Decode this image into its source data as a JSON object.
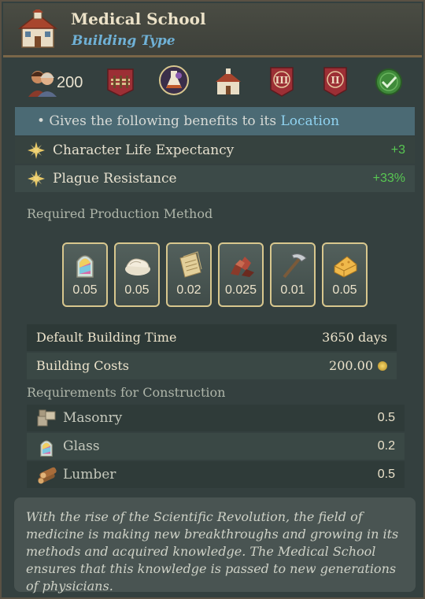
{
  "header": {
    "title": "Medical School",
    "subtitle": "Building Type",
    "icon": "school-building-icon"
  },
  "icon_bar": {
    "population": "200",
    "items": [
      "population-icon",
      "railway-icon",
      "medicine-flask-icon",
      "school-building-icon",
      "tier-three-banner-icon",
      "tier-two-banner-icon",
      "checkmark-icon"
    ],
    "tier_labels": [
      "III",
      "II"
    ]
  },
  "benefits": {
    "intro_prefix": "• Gives the following benefits to its ",
    "intro_link": "Location",
    "modifiers": [
      {
        "label": "Character Life Expectancy",
        "value": "+3"
      },
      {
        "label": "Plague Resistance",
        "value": "+33%"
      }
    ]
  },
  "production": {
    "label": "Required Production Method",
    "goods": [
      {
        "icon": "glass-icon",
        "amount": "0.05"
      },
      {
        "icon": "cloth-icon",
        "amount": "0.05"
      },
      {
        "icon": "paper-icon",
        "amount": "0.02"
      },
      {
        "icon": "copper-ore-icon",
        "amount": "0.025"
      },
      {
        "icon": "tools-icon",
        "amount": "0.01"
      },
      {
        "icon": "cheese-icon",
        "amount": "0.05"
      }
    ]
  },
  "building_time": {
    "label": "Default Building Time",
    "value": "3650 days"
  },
  "building_costs": {
    "label": "Building Costs",
    "value": "200.00"
  },
  "requirements": {
    "label": "Requirements for Construction",
    "items": [
      {
        "icon": "masonry-icon",
        "label": "Masonry",
        "value": "0.5"
      },
      {
        "icon": "glass-icon",
        "label": "Glass",
        "value": "0.2"
      },
      {
        "icon": "lumber-icon",
        "label": "Lumber",
        "value": "0.5"
      }
    ]
  },
  "description": "With the rise of the Scientific Revolution, the field of medicine is making new breakthroughs and growing in its methods and acquired knowledge. The Medical School ensures that this knowledge is passed to new generations of physicians.",
  "colors": {
    "accent_link": "#8fd2f0",
    "positive": "#58c752",
    "frame": "#d8c78e"
  }
}
